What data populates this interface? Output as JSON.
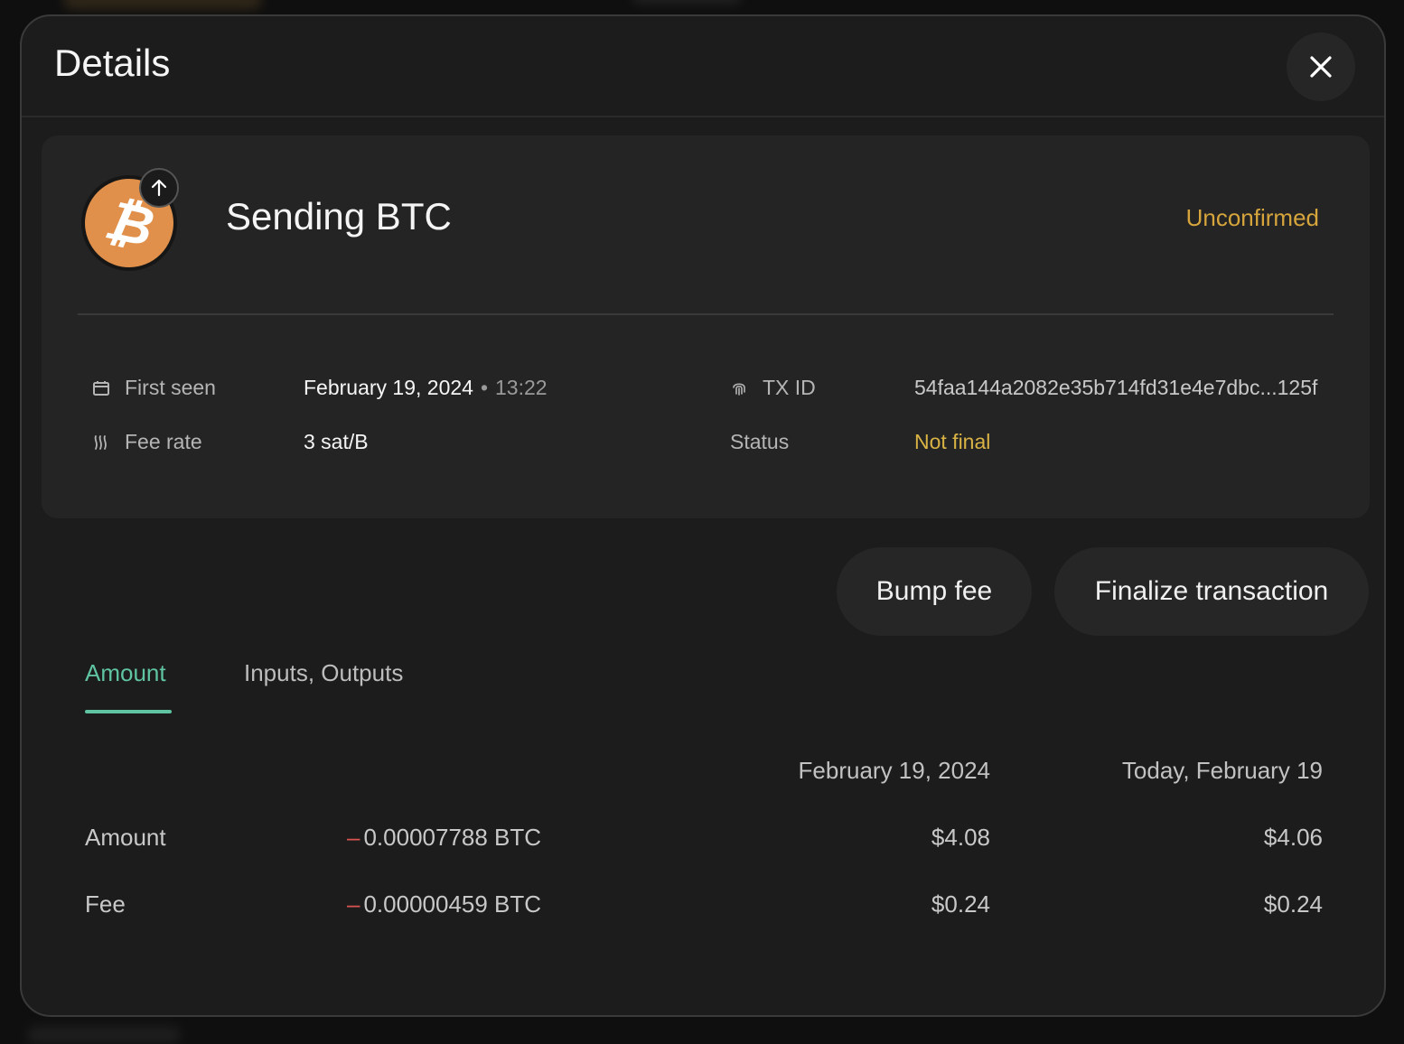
{
  "modal": {
    "title": "Details"
  },
  "transaction": {
    "title": "Sending BTC",
    "state": "Unconfirmed",
    "first_seen_label": "First seen",
    "first_seen_date": "February 19, 2024",
    "first_seen_time": "13:22",
    "fee_rate_label": "Fee rate",
    "fee_rate_value": "3 sat/B",
    "txid_label": "TX ID",
    "txid_value": "54faa144a2082e35b714fd31e4e7dbc...125f",
    "status_label": "Status",
    "status_value": "Not final"
  },
  "actions": {
    "bump_fee": "Bump fee",
    "finalize": "Finalize transaction"
  },
  "tabs": [
    {
      "label": "Amount",
      "active": true
    },
    {
      "label": "Inputs, Outputs",
      "active": false
    }
  ],
  "amounts": {
    "col_then": "February 19, 2024",
    "col_now": "Today, February 19",
    "rows": [
      {
        "label": "Amount",
        "sign": "–",
        "btc": "0.00007788 BTC",
        "then": "$4.08",
        "now": "$4.06"
      },
      {
        "label": "Fee",
        "sign": "–",
        "btc": "0.00000459 BTC",
        "then": "$0.24",
        "now": "$0.24"
      }
    ]
  },
  "colors": {
    "accent": "#5fc4a1",
    "warning": "#d6a53c",
    "negative": "#d9534f",
    "btc": "#e0904a"
  },
  "icons": {
    "close": "close-icon",
    "coin": "bitcoin-icon",
    "direction": "arrow-up-icon",
    "calendar": "calendar-icon",
    "fee": "fee-rate-icon",
    "fingerprint": "fingerprint-icon"
  }
}
